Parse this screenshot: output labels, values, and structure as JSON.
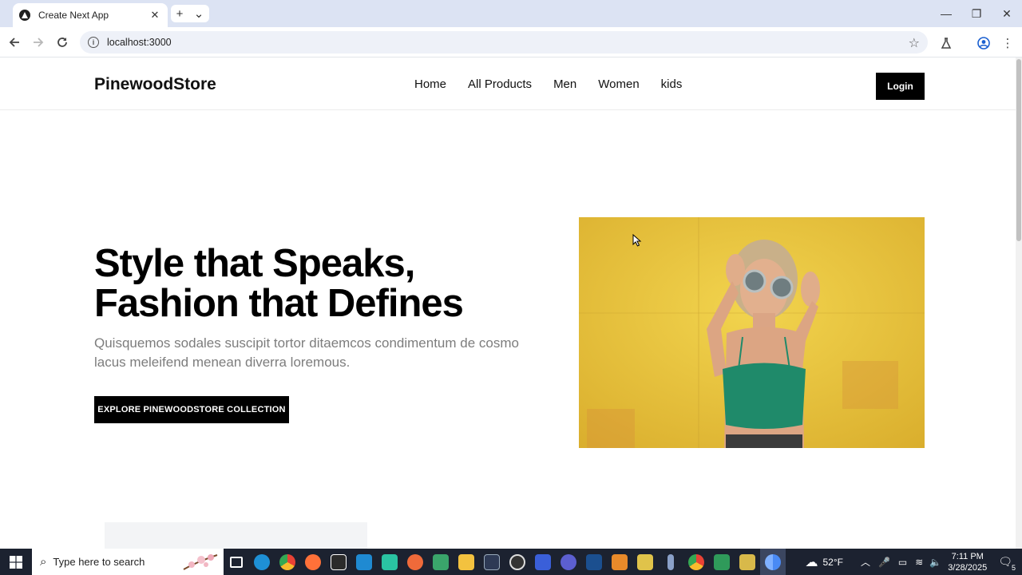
{
  "browser": {
    "tab_title": "Create Next App",
    "tab_close": "✕",
    "new_tab": "+",
    "tab_list": "⌄",
    "window_controls": {
      "minimize": "—",
      "restore": "❐",
      "close": "✕"
    },
    "url": "localhost:3000"
  },
  "site": {
    "logo": "PinewoodStore",
    "nav": [
      "Home",
      "All Products",
      "Men",
      "Women",
      "kids"
    ],
    "login_label": "Login"
  },
  "hero": {
    "title_line1": "Style that Speaks,",
    "title_line2": "Fashion that Defines",
    "subtitle": "Quisquemos sodales suscipit tortor ditaemcos condimentum de cosmo lacus meleifend menean diverra loremous.",
    "cta_label": "EXPLORE PINEWOODSTORE COLLECTION",
    "image": "woman-with-sunglasses-yellow-wall-photo"
  },
  "taskbar": {
    "search_placeholder": "Type here to search",
    "apps": [
      "task-view",
      "edge",
      "chrome",
      "firefox",
      "epic-games",
      "vscode",
      "app-green",
      "app-orange",
      "app-green2",
      "file-explorer",
      "app-dark",
      "obs",
      "app-blue",
      "app-purple",
      "app-blue2",
      "sublime",
      "app-yellow",
      "microphone",
      "chrome2",
      "app-green3",
      "app-yellow2",
      "chrome-active"
    ],
    "weather": "52°F",
    "time": "7:11 PM",
    "date": "3/28/2025",
    "notifications": "5"
  },
  "colors": {
    "chrome_tabbar": "#dce3f3",
    "accent_black": "#000000",
    "subtitle_gray": "#7d7d7d",
    "hero_image_bg": "#e8c43a",
    "taskbar": "#1c2230"
  }
}
